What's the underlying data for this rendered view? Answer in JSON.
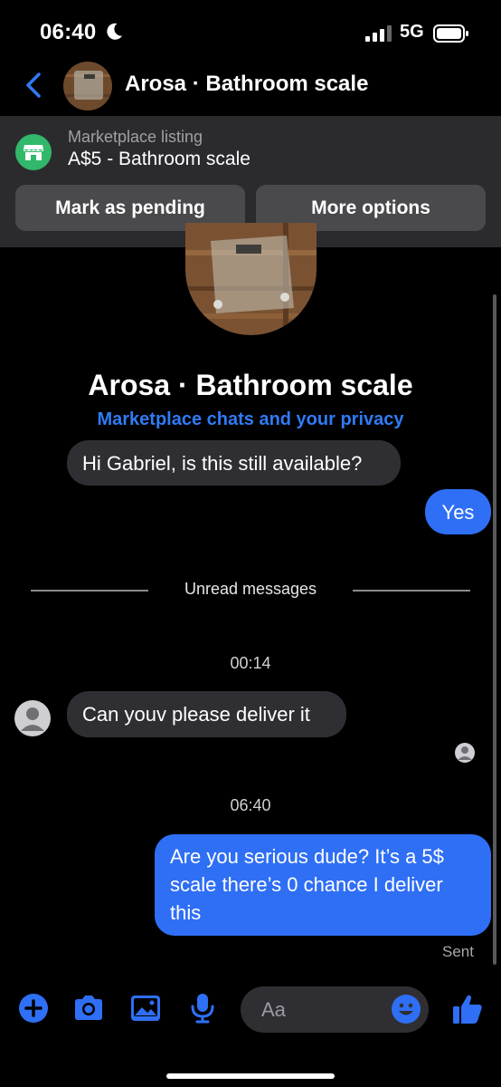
{
  "status_bar": {
    "time": "06:40",
    "network": "5G"
  },
  "header": {
    "title": "Arosa · Bathroom scale"
  },
  "listing": {
    "subtitle": "Marketplace listing",
    "title": "A$5 - Bathroom scale",
    "mark_pending_label": "Mark as pending",
    "more_options_label": "More options"
  },
  "conversation": {
    "title": "Arosa · Bathroom scale",
    "privacy_link": "Marketplace chats and your privacy",
    "unread_label": "Unread messages",
    "messages": [
      {
        "direction": "incoming",
        "text": "Hi Gabriel, is this still available?"
      },
      {
        "direction": "outgoing",
        "text": "Yes"
      },
      {
        "timestamp": "00:14"
      },
      {
        "direction": "incoming",
        "text": "Can youv please deliver it"
      },
      {
        "timestamp": "06:40"
      },
      {
        "direction": "outgoing",
        "text": "Are you serious dude? It’s a 5$ scale there’s 0 chance I deliver this"
      }
    ],
    "sent_label": "Sent"
  },
  "composer": {
    "placeholder": "Aa"
  },
  "icons": {
    "back": "chevron-left-icon",
    "moon": "moon-icon",
    "store": "storefront-icon",
    "plus": "plus-icon",
    "camera": "camera-icon",
    "gallery": "image-icon",
    "mic": "microphone-icon",
    "emoji": "emoji-icon",
    "like": "thumbs-up-icon"
  },
  "colors": {
    "accent": "#2f6ff5",
    "link": "#2f7bf6",
    "marketplace_green": "#32b86a",
    "incoming_bubble": "#2f2f33",
    "banner_bg": "#2b2b2e"
  }
}
